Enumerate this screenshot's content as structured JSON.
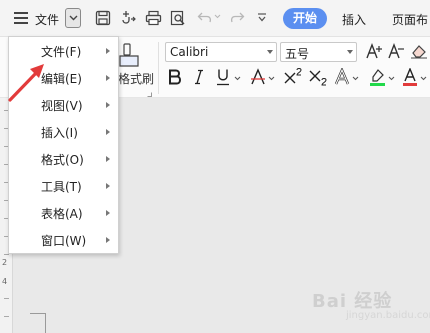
{
  "toolbar": {
    "file_label": "文件",
    "start_tab": "开始",
    "insert_tab": "插入",
    "layout_tab": "页面布"
  },
  "ribbon": {
    "font_name": "Calibri",
    "font_size": "五号",
    "format_painter_label": "格式刷"
  },
  "menu": {
    "items": [
      {
        "label": "文件(F)"
      },
      {
        "label": "编辑(E)"
      },
      {
        "label": "视图(V)"
      },
      {
        "label": "插入(I)"
      },
      {
        "label": "格式(O)"
      },
      {
        "label": "工具(T)"
      },
      {
        "label": "表格(A)"
      },
      {
        "label": "窗口(W)"
      }
    ]
  },
  "ruler": {
    "numbers": [
      "2",
      "4"
    ]
  },
  "watermark": {
    "text": "Bai 经验",
    "sub": "jingyan.baidu.com"
  },
  "colors": {
    "accent": "#5b8ff0",
    "arrow": "#e23b3b",
    "highlight_bar": "#22d94a",
    "font_color_bar": "#e23b3b"
  }
}
